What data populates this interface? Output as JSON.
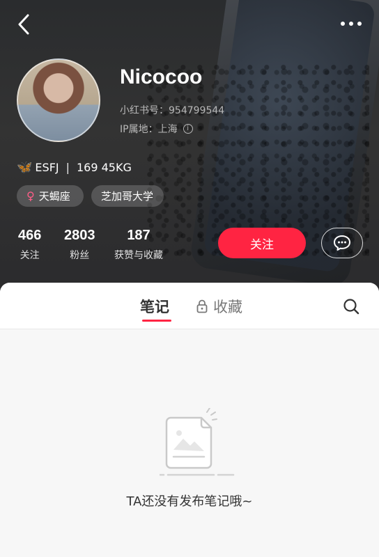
{
  "header": {
    "username": "Nicocoo",
    "xhs_id_line": "小红书号：954799544",
    "ip_location_line": "IP属地：上海",
    "bio": {
      "mbti": "ESFJ",
      "separator": "|",
      "body": "169 45KG"
    },
    "tags": {
      "gender_label": "天蝎座",
      "school": "芝加哥大学"
    },
    "stats": [
      {
        "count": "466",
        "label": "关注"
      },
      {
        "count": "2803",
        "label": "粉丝"
      },
      {
        "count": "187",
        "label": "获赞与收藏"
      }
    ],
    "follow_button": "关注"
  },
  "tabs": [
    {
      "label": "笔记",
      "active": true
    },
    {
      "label": "收藏",
      "active": false,
      "locked": true
    }
  ],
  "empty_state": {
    "message": "TA还没有发布笔记哦~"
  },
  "colors": {
    "accent_red": "#ff2442",
    "header_dark": "#2f3134",
    "female_pink": "#ff5d88",
    "content_bg": "#f7f7f7"
  },
  "icons": {
    "back": "back-chevron-icon",
    "more": "more-dots-icon",
    "info": "info-icon",
    "butterfly": "butterfly-icon",
    "female": "female-symbol-icon",
    "chat": "chat-bubble-icon",
    "lock": "lock-icon",
    "search": "search-icon",
    "empty": "empty-note-illustration"
  }
}
